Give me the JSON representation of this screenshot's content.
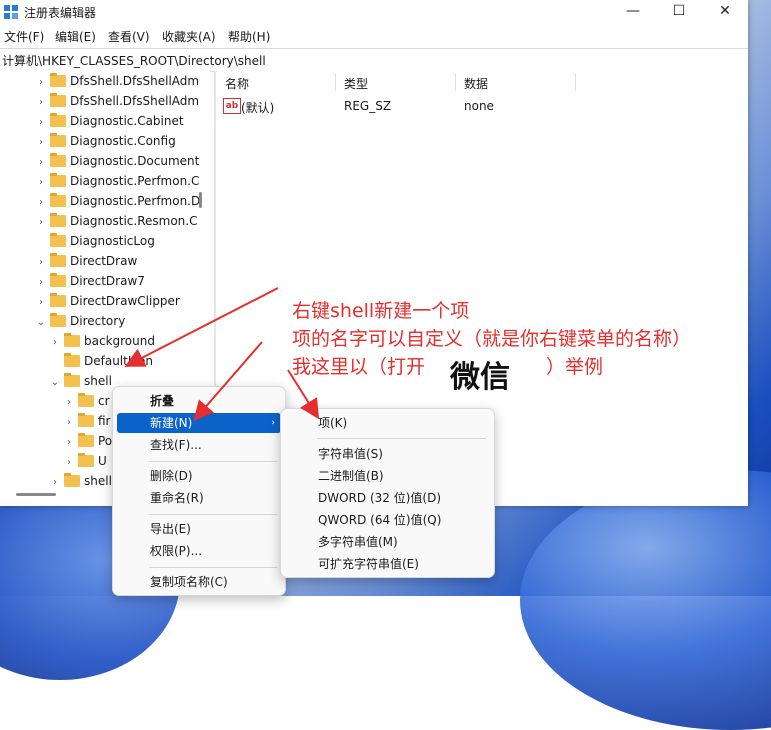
{
  "window": {
    "title": "注册表编辑器",
    "minimize_symbol": "—",
    "maximize_symbol": "☐",
    "close_symbol": "✕"
  },
  "menu": [
    "文件(F)",
    "编辑(E)",
    "查看(V)",
    "收藏夹(A)",
    "帮助(H)"
  ],
  "address": "计算机\\HKEY_CLASSES_ROOT\\Directory\\shell",
  "tree": [
    {
      "label": "DfsShell.DfsShellAdm",
      "chevron": "›"
    },
    {
      "label": "DfsShell.DfsShellAdm",
      "chevron": "›"
    },
    {
      "label": "Diagnostic.Cabinet",
      "chevron": "›"
    },
    {
      "label": "Diagnostic.Config",
      "chevron": "›"
    },
    {
      "label": "Diagnostic.Document",
      "chevron": "›"
    },
    {
      "label": "Diagnostic.Perfmon.C",
      "chevron": "›"
    },
    {
      "label": "Diagnostic.Perfmon.D",
      "chevron": "›"
    },
    {
      "label": "Diagnostic.Resmon.C",
      "chevron": "›"
    },
    {
      "label": "DiagnosticLog",
      "chevron": ""
    },
    {
      "label": "DirectDraw",
      "chevron": "›"
    },
    {
      "label": "DirectDraw7",
      "chevron": "›"
    },
    {
      "label": "DirectDrawClipper",
      "chevron": "›"
    },
    {
      "label": "Directory",
      "chevron": "⌄"
    },
    {
      "label": "background",
      "chevron": "›"
    },
    {
      "label": "DefaultIcon",
      "chevron": ""
    },
    {
      "label": "shell",
      "chevron": "⌄"
    },
    {
      "label": "cr",
      "chevron": "›"
    },
    {
      "label": "fir",
      "chevron": "›"
    },
    {
      "label": "Po",
      "chevron": "›"
    },
    {
      "label": "U",
      "chevron": "›"
    },
    {
      "label": "shell",
      "chevron": "›"
    }
  ],
  "columns": {
    "name": "名称",
    "type": "类型",
    "data": "数据"
  },
  "value_row": {
    "icon": "ab",
    "name": "(默认)",
    "type": "REG_SZ",
    "data": "none"
  },
  "context_menu": {
    "items": [
      "折叠",
      "新建(N)",
      "查找(F)...",
      "删除(D)",
      "重命名(R)",
      "导出(E)",
      "权限(P)...",
      "复制项名称(C)"
    ]
  },
  "submenu": {
    "items": [
      "项(K)",
      "字符串值(S)",
      "二进制值(B)",
      "DWORD (32 位)值(D)",
      "QWORD (64 位)值(Q)",
      "多字符串值(M)",
      "可扩充字符串值(E)"
    ]
  },
  "annotation": {
    "line1": "右键shell新建一个项",
    "line2": "项的名字可以自定义（就是你右键菜单的名称）",
    "line3_prefix": "我这里以（打开",
    "line3_highlight": "微信",
    "line3_suffix": "）举例",
    "color": "#e52e2e"
  }
}
